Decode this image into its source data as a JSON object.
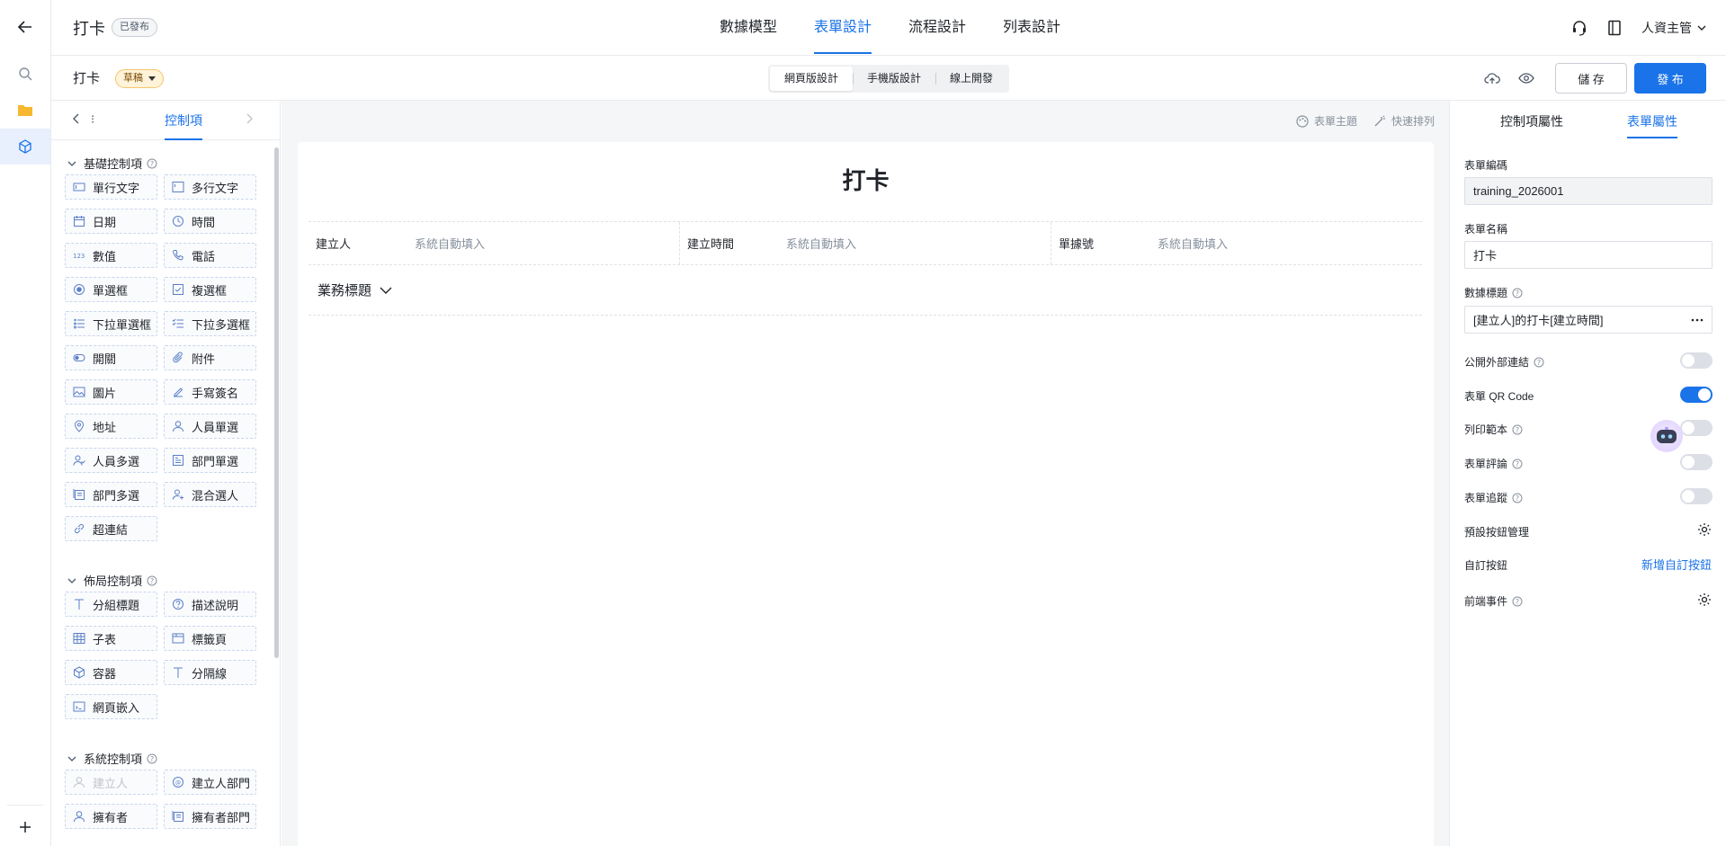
{
  "header": {
    "title": "打卡",
    "status": "已發布",
    "tabs": [
      {
        "label": "數據模型"
      },
      {
        "label": "表單設計"
      },
      {
        "label": "流程設計"
      },
      {
        "label": "列表設計"
      }
    ],
    "user": "人資主管"
  },
  "subbar": {
    "title": "打卡",
    "draft": "草稿",
    "modes": [
      {
        "label": "網頁版設計"
      },
      {
        "label": "手機版設計"
      },
      {
        "label": "線上開發"
      }
    ],
    "save": "儲 存",
    "publish": "發 布"
  },
  "palette": {
    "more": "⁝",
    "tab": "控制項",
    "sections": [
      {
        "title": "基礎控制項",
        "items": [
          "單行文字",
          "多行文字",
          "日期",
          "時間",
          "數值",
          "電話",
          "單選框",
          "複選框",
          "下拉單選框",
          "下拉多選框",
          "開關",
          "附件",
          "圖片",
          "手寫簽名",
          "地址",
          "人員單選",
          "人員多選",
          "部門單選",
          "部門多選",
          "混合選人",
          "超連結"
        ]
      },
      {
        "title": "佈局控制項",
        "items": [
          "分組標題",
          "描述說明",
          "子表",
          "標籤頁",
          "容器",
          "分隔線",
          "網頁嵌入"
        ]
      },
      {
        "title": "系統控制項",
        "items": [
          "建立人",
          "建立人部門",
          "擁有者",
          "擁有者部門"
        ]
      }
    ]
  },
  "canvas": {
    "tools": [
      "表單主題",
      "快速排列"
    ],
    "form_title": "打卡",
    "system_fields": [
      {
        "label": "建立人",
        "value": "系統自動填入"
      },
      {
        "label": "建立時間",
        "value": "系統自動填入"
      },
      {
        "label": "單據號",
        "value": "系統自動填入"
      }
    ],
    "business_title": "業務標題"
  },
  "props": {
    "tabs": [
      "控制項屬性",
      "表單屬性"
    ],
    "code_label": "表單編碼",
    "code_value": "training_2026001",
    "name_label": "表單名稱",
    "name_value": "打卡",
    "data_title_label": "數據標題",
    "data_title_value": "[建立人]的打卡[建立時間]",
    "public_link": "公開外部連結",
    "qr_code": "表單 QR Code",
    "print_template": "列印範本",
    "comment": "表單評論",
    "tracking": "表單追蹤",
    "default_buttons": "預設按鈕管理",
    "custom_buttons": "自訂按鈕",
    "add_custom": "新增自訂按鈕",
    "frontend_events": "前端事件",
    "qr_on": true,
    "public_on": false,
    "print_on": false,
    "comment_on": false,
    "tracking_on": false
  },
  "colors": {
    "accent": "#1a73e8",
    "border": "#e8eaed",
    "muted": "#86909c"
  }
}
